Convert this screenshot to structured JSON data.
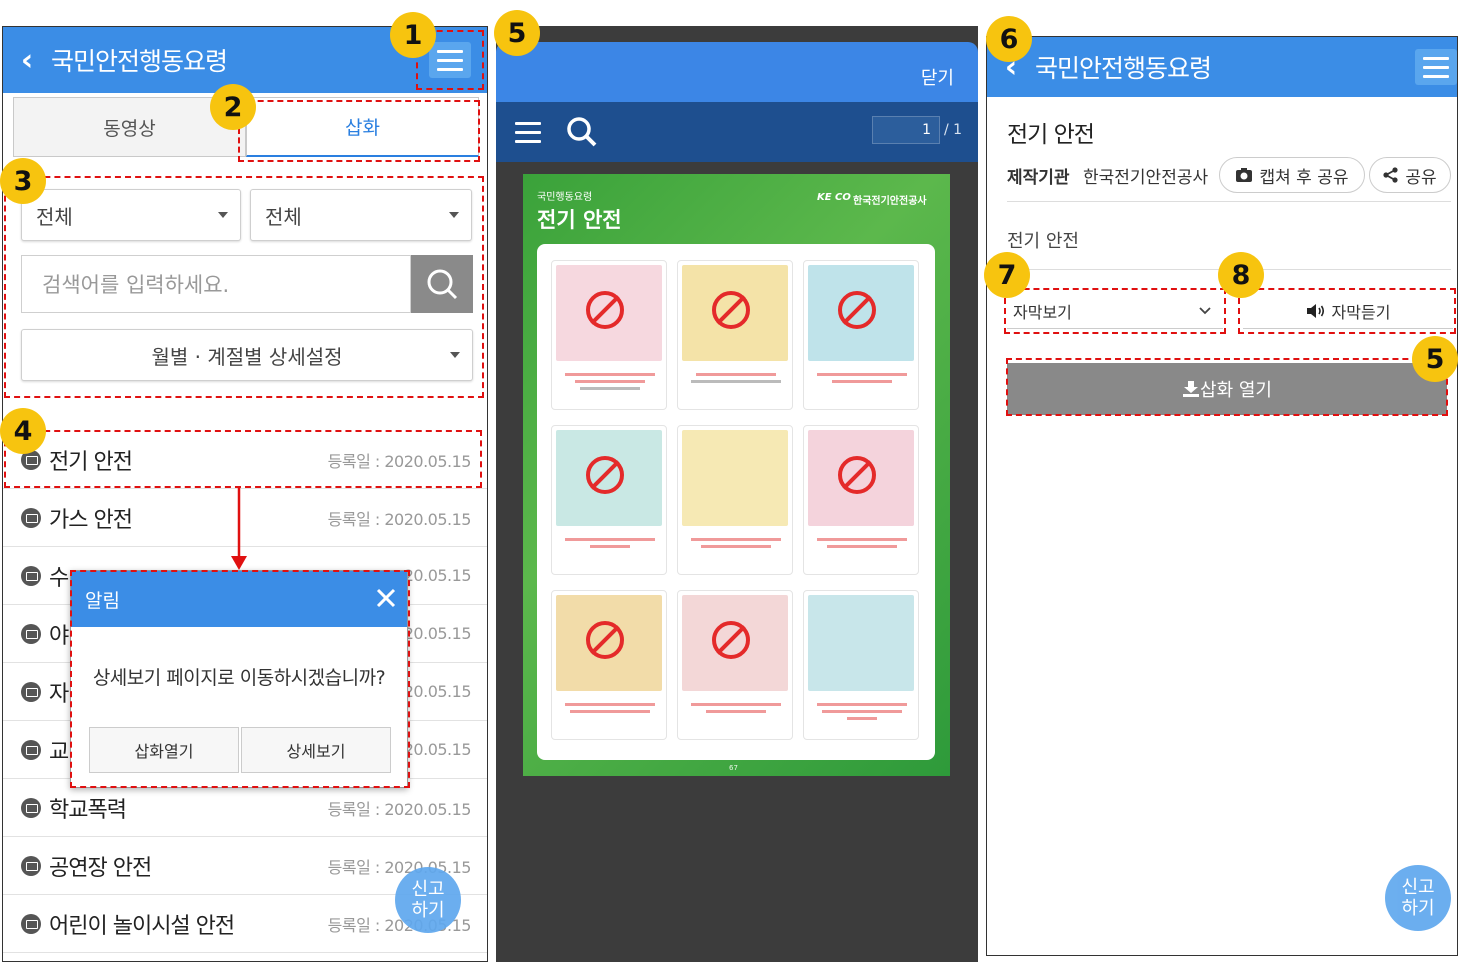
{
  "panel1": {
    "header": {
      "back_icon": "chevron-left-icon",
      "title": "국민안전행동요령",
      "menu_icon": "hamburger-menu-icon"
    },
    "tabs": [
      {
        "label": "동영상",
        "active": false
      },
      {
        "label": "삽화",
        "active": true
      }
    ],
    "filters": {
      "select1": "전체",
      "select2": "전체",
      "search_placeholder": "검색어를 입력하세요.",
      "detail_select": "월별 · 계절별 상세설정"
    },
    "list": [
      {
        "title": "전기 안전",
        "date": "등록일 : 2020.05.15"
      },
      {
        "title": "가스 안전",
        "date": "등록일 : 2020.05.15"
      },
      {
        "title": "수",
        "date": "20.05.15"
      },
      {
        "title": "야",
        "date": "20.05.15"
      },
      {
        "title": "자",
        "date": "20.05.15"
      },
      {
        "title": "교",
        "date": "20.05.15"
      },
      {
        "title": "학교폭력",
        "date": "등록일 : 2020.05.15"
      },
      {
        "title": "공연장 안전",
        "date": "등록일 : 2020.05.15"
      },
      {
        "title": "어린이 놀이시설 안전",
        "date": "등록일 : 2020.05.15"
      }
    ],
    "dialog": {
      "title": "알림",
      "message": "상세보기 페이지로 이동하시겠습니까?",
      "button_open": "삽화열기",
      "button_detail": "상세보기"
    },
    "report_button": {
      "line1": "신고",
      "line2": "하기"
    }
  },
  "panel2": {
    "close_label": "닫기",
    "page_current": "1",
    "page_total": "/ 1",
    "poster": {
      "subtitle": "국민행동요령",
      "title": "전기 안전",
      "org": "한국전기안전공사",
      "org_logo_text": "KE CO",
      "page_number": "67"
    }
  },
  "panel3": {
    "header": {
      "title": "국민안전행동요령"
    },
    "content_title": "전기 안전",
    "producer_label": "제작기관",
    "producer": "한국전기안전공사",
    "capture_share": "캡쳐 후 공유",
    "share": "공유",
    "section_title": "전기 안전",
    "subtitle_select": "자막보기",
    "subtitle_listen": "자막듣기",
    "open_illustration": "삽화 열기",
    "report_button": {
      "line1": "신고",
      "line2": "하기"
    }
  },
  "annotations": {
    "b1": "1",
    "b2": "2",
    "b3": "3",
    "b4": "4",
    "b5a": "5",
    "b5b": "5",
    "b6": "6",
    "b7": "7",
    "b8": "8"
  },
  "colors": {
    "header_blue": "#3b8de6",
    "annotation_red": "#e01010",
    "badge_yellow": "#f7c40f",
    "poster_green": "#4caf50"
  }
}
